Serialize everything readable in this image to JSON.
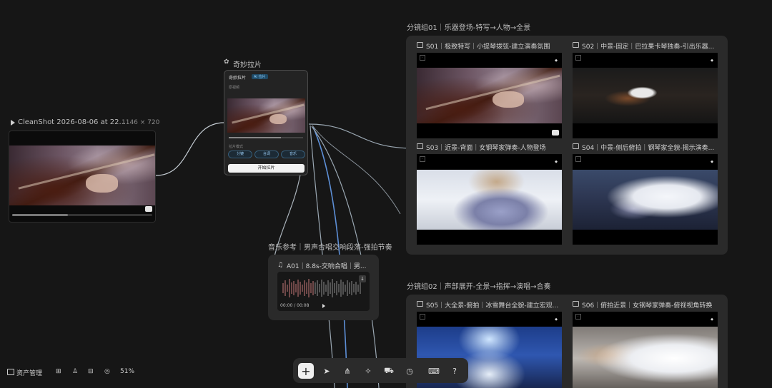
{
  "source_node": {
    "title": "CleanShot 2026-08-06 at 22...",
    "dims": "1146 × 720"
  },
  "lapian_node": {
    "title": "奇妙拉片",
    "header": "奇妙拉片",
    "badge": "AI 拉片",
    "video_label": "原视频",
    "options_label": "拉片模式",
    "chip_1": "分镜",
    "chip_2": "台词",
    "chip_3": "音乐",
    "start_button": "开始拉片"
  },
  "group_1": {
    "title": "分镜组01｜乐器登场-特写→人物→全景",
    "shots": [
      {
        "title": "S01｜极致特写｜小提琴拨弦-建立演奏氛围"
      },
      {
        "title": "S02｜中景-固定｜巴拉果卡琴独奏-引出乐器..."
      },
      {
        "title": "S03｜近景-背面｜女钢琴家弹奏-人物登场"
      },
      {
        "title": "S04｜中景-侧后俯拍｜钢琴家全貌-揭示演奏..."
      }
    ]
  },
  "group_2": {
    "title": "分镜组02｜声部展开-全景→指挥→演唱→合奏",
    "shots": [
      {
        "title": "S05｜大全景-俯拍｜冰雪舞台全貌-建立宏观..."
      },
      {
        "title": "S06｜俯拍近景｜女钢琴家弹奏-俯视视角转换"
      }
    ]
  },
  "audio_node": {
    "title": "音乐参考｜男声合唱交响段落-强拍节奏",
    "card_title": "A01｜8.8s-交响合唱｜男...",
    "time": "00:00 / 00:08"
  },
  "bottom_left": {
    "assets_label": "资产管理",
    "zoom": "51%"
  },
  "toolbar": {
    "tools": [
      "plus-icon",
      "pointer-icon",
      "share-nodes-icon",
      "magic-wand-icon",
      "car-icon",
      "clock-icon",
      "keyboard-icon",
      "help-icon"
    ],
    "active": "plus-icon"
  },
  "colors": {
    "canvas": "#161616",
    "panel": "#2a2a2a",
    "wire": "#9aa7b2",
    "wire_active": "#5d8fd6",
    "accent": "#8fd0ff"
  }
}
